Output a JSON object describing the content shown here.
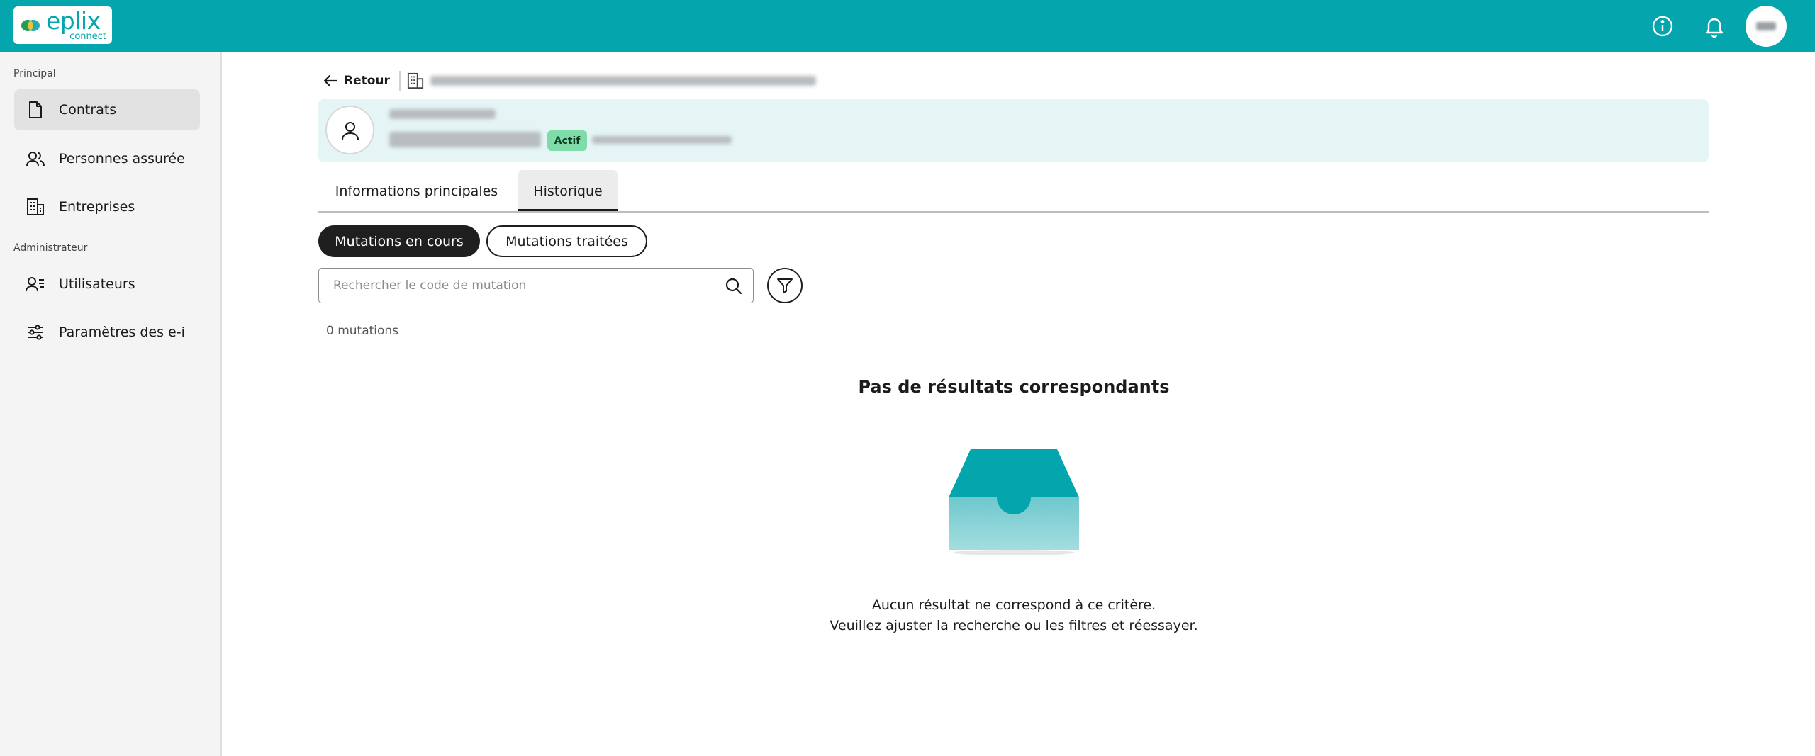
{
  "brand": {
    "name": "eplix",
    "sub": "connect"
  },
  "sidebar": {
    "sections": [
      {
        "title": "Principal",
        "items": [
          {
            "label": "Contrats",
            "icon": "document-icon",
            "active": true
          },
          {
            "label": "Personnes assurée",
            "icon": "people-icon"
          },
          {
            "label": "Entreprises",
            "icon": "building-icon"
          }
        ]
      },
      {
        "title": "Administrateur",
        "items": [
          {
            "label": "Utilisateurs",
            "icon": "user-card-icon"
          },
          {
            "label": "Paramètres des e-i",
            "icon": "sliders-icon"
          }
        ]
      }
    ]
  },
  "breadcrumb": {
    "back_label": "Retour"
  },
  "person": {
    "status": "Actif"
  },
  "tabs": [
    {
      "label": "Informations principales",
      "active": false
    },
    {
      "label": "Historique",
      "active": true
    }
  ],
  "filters": {
    "active_label": "Mutations en cours",
    "inactive_label": "Mutations traitées"
  },
  "search": {
    "placeholder": "Rechercher le code de mutation",
    "value": ""
  },
  "count_label": "0 mutations",
  "empty_state": {
    "title": "Pas de résultats correspondants",
    "line1": "Aucun résultat ne correspond à ce critère.",
    "line2": "Veuillez ajuster la recherche ou les filtres et réessayer."
  },
  "colors": {
    "brand": "#05a5ad",
    "status_active": "#7fdca8",
    "card_bg": "#e5f5f6"
  }
}
